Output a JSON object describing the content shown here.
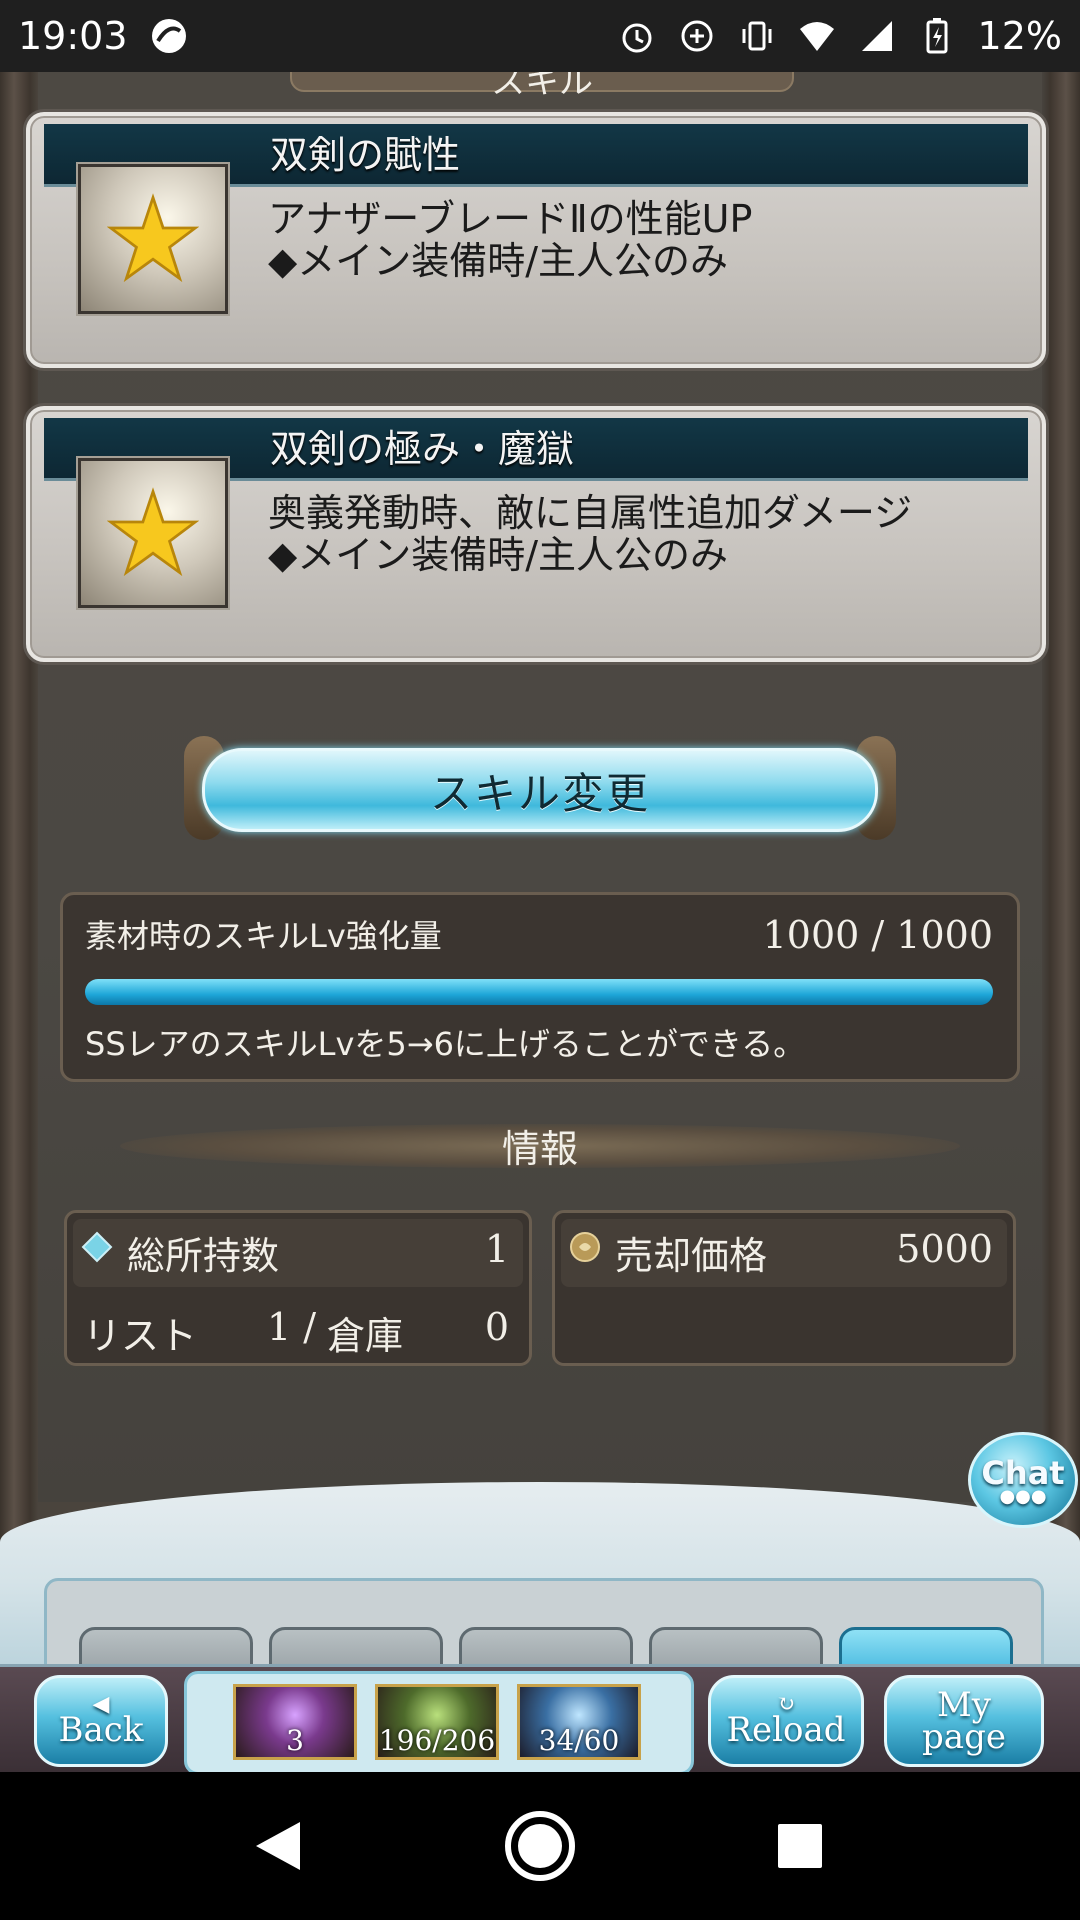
{
  "status_bar": {
    "time": "19:03",
    "battery": "12%"
  },
  "section_tab_title": "スキル",
  "skills": [
    {
      "name": "双剣の賦性",
      "desc_line1": "アナザーブレードⅡの性能UP",
      "desc_line2": "◆メイン装備時/主人公のみ"
    },
    {
      "name": "双剣の極み・魔獄",
      "desc_line1": "奥義発動時、敵に自属性追加ダメージ",
      "desc_line2": "◆メイン装備時/主人公のみ"
    }
  ],
  "change_button": {
    "label": "スキル変更"
  },
  "skill_lv": {
    "label": "素材時のスキルLv強化量",
    "value": "1000 / 1000",
    "progress": 1.0,
    "note": "SSレアのスキルLvを5→6に上げることができる。"
  },
  "info": {
    "title": "情報",
    "owned_label": "総所持数",
    "owned_value": "1",
    "list_label": "リスト",
    "list_value": "1 /",
    "storage_label": "倉庫",
    "storage_value": "0",
    "sell_label": "売却価格",
    "sell_value": "5000"
  },
  "chat_button": {
    "label": "Chat"
  },
  "footer": {
    "back_label": "Back",
    "reload_label": "Reload",
    "mypage_label_1": "My",
    "mypage_label_2": "page",
    "items": [
      {
        "count": "3"
      },
      {
        "count": "196/206"
      },
      {
        "count": "34/60"
      }
    ]
  },
  "colors": {
    "accent": "#2aa9d8",
    "panel": "#4b4843",
    "card": "#c7c3be"
  }
}
